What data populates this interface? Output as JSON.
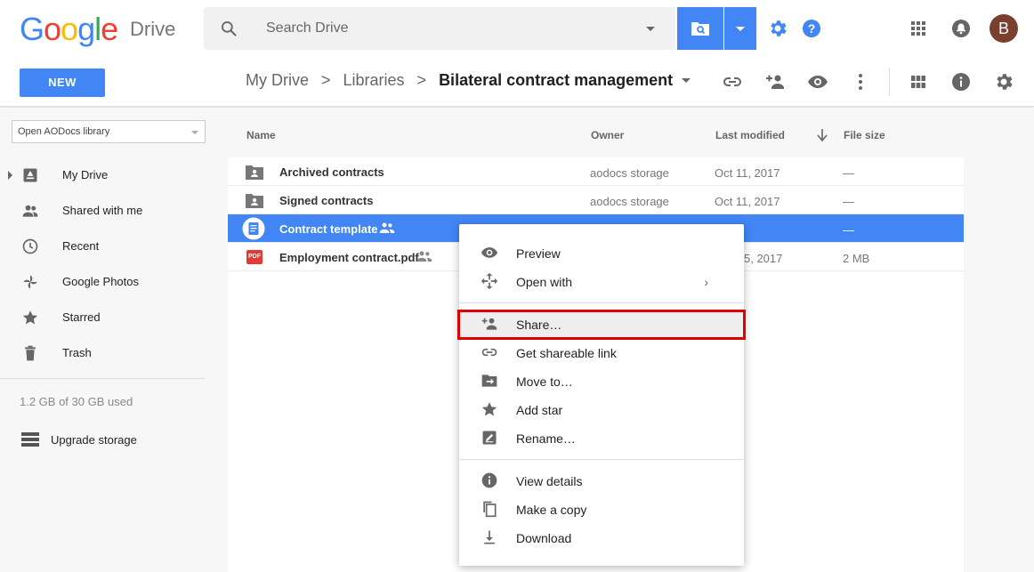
{
  "header": {
    "logo_letters": [
      "G",
      "o",
      "o",
      "g",
      "l",
      "e"
    ],
    "logo_colors": [
      "#4285f4",
      "#ea4335",
      "#fbbc05",
      "#4285f4",
      "#34a853",
      "#ea4335"
    ],
    "product": "Drive",
    "search_placeholder": "Search Drive",
    "avatar_initial": "B",
    "icons": [
      "search-icon",
      "folder-search-icon",
      "gear-icon",
      "help-icon",
      "apps-grid-icon",
      "notifications-icon"
    ]
  },
  "toolbar": {
    "new_label": "NEW",
    "breadcrumb": [
      "My Drive",
      "Libraries"
    ],
    "breadcrumb_current": "Bilateral contract management",
    "icons": [
      "link-icon",
      "add-person-icon",
      "preview-eye-icon",
      "more-vert-icon",
      "grid-view-icon",
      "info-icon",
      "settings-icon"
    ]
  },
  "sidebar": {
    "library_select": "Open AODocs library",
    "items": [
      {
        "label": "My Drive",
        "icon": "drive-icon"
      },
      {
        "label": "Shared with me",
        "icon": "people-icon"
      },
      {
        "label": "Recent",
        "icon": "clock-icon"
      },
      {
        "label": "Google Photos",
        "icon": "photos-pinwheel-icon"
      },
      {
        "label": "Starred",
        "icon": "star-icon"
      },
      {
        "label": "Trash",
        "icon": "trash-icon"
      }
    ],
    "storage_text": "1.2 GB of 30 GB used",
    "upgrade_label": "Upgrade storage"
  },
  "list": {
    "columns": {
      "name": "Name",
      "owner": "Owner",
      "modified": "Last modified",
      "size": "File size"
    },
    "rows": [
      {
        "name": "Archived contracts",
        "owner": "aodocs storage",
        "modified": "Oct 11, 2017",
        "size": "—",
        "type": "shared-folder",
        "shared": false,
        "selected": false
      },
      {
        "name": "Signed contracts",
        "owner": "aodocs storage",
        "modified": "Oct 11, 2017",
        "size": "—",
        "type": "shared-folder",
        "shared": false,
        "selected": false
      },
      {
        "name": "Contract template",
        "owner": "",
        "modified": "PM",
        "size": "—",
        "type": "doc",
        "shared": true,
        "selected": true
      },
      {
        "name": "Employment contract.pdf",
        "owner": "",
        "modified": "5, 2017",
        "size": "2 MB",
        "type": "pdf",
        "shared": true,
        "selected": false
      }
    ]
  },
  "context_menu": {
    "items": [
      {
        "label": "Preview",
        "icon": "eye-icon"
      },
      {
        "label": "Open with",
        "icon": "move-arrows-icon",
        "submenu": true
      },
      {
        "label": "Share…",
        "icon": "add-person-icon",
        "highlighted": true
      },
      {
        "label": "Get shareable link",
        "icon": "link-icon"
      },
      {
        "label": "Move to…",
        "icon": "move-folder-icon"
      },
      {
        "label": "Add star",
        "icon": "star-icon"
      },
      {
        "label": "Rename…",
        "icon": "rename-icon"
      },
      {
        "label": "View details",
        "icon": "info-icon"
      },
      {
        "label": "Make a copy",
        "icon": "copy-icon"
      },
      {
        "label": "Download",
        "icon": "download-icon"
      }
    ],
    "submenu_arrow": "›"
  },
  "colors": {
    "accent": "#4285f4",
    "highlight_box": "#e00000"
  },
  "pdf_badge": "PDF"
}
